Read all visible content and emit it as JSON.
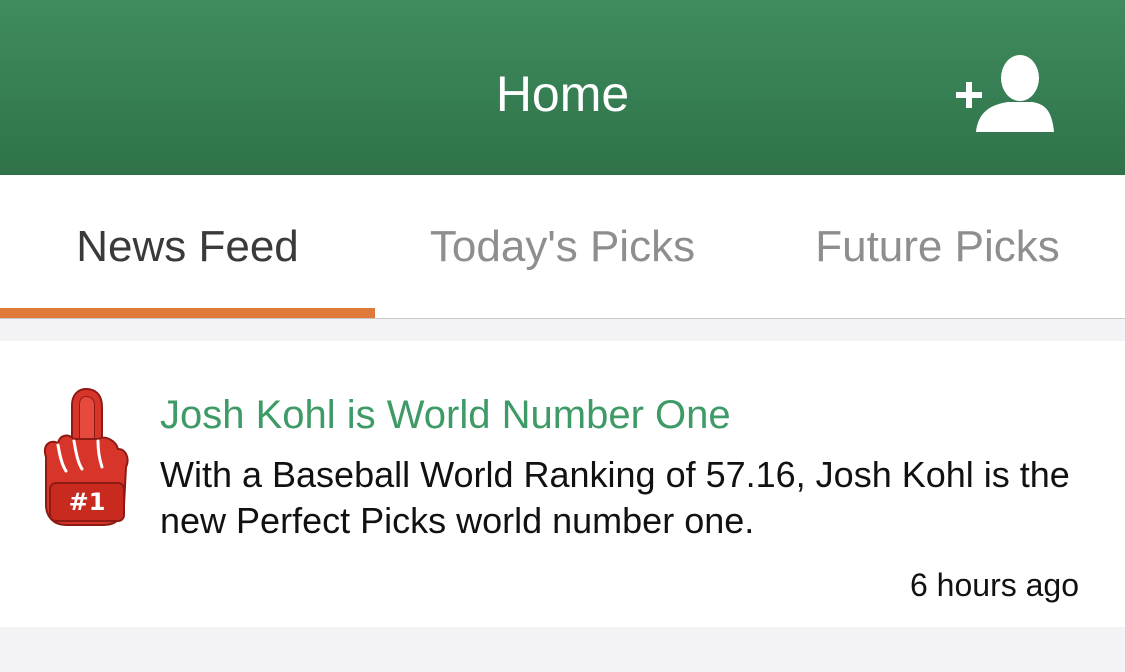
{
  "header": {
    "title": "Home",
    "add_user_icon": "add-user-icon"
  },
  "tabs": [
    {
      "label": "News Feed",
      "active": true
    },
    {
      "label": "Today's Picks",
      "active": false
    },
    {
      "label": "Future Picks",
      "active": false
    }
  ],
  "colors": {
    "header_green": "#3a8457",
    "accent_orange": "#e07a3a",
    "title_green": "#3e9a66",
    "badge_red": "#d8352a"
  },
  "feed": [
    {
      "icon": "foam-finger-icon",
      "badge_text": "#1",
      "title": "Josh Kohl is World Number One",
      "body": "With a Baseball World Ranking of 57.16, Josh Kohl is the new Perfect Picks world number one.",
      "time": "6 hours ago"
    }
  ]
}
